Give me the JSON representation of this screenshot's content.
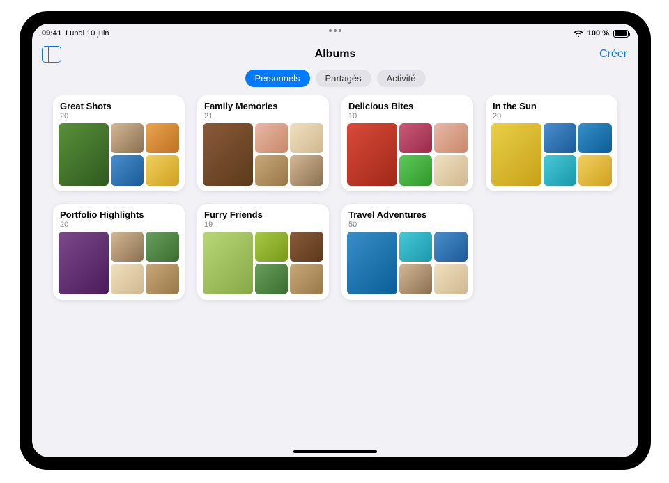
{
  "status": {
    "time": "09:41",
    "date": "Lundi 10 juin",
    "battery_pct": "100 %"
  },
  "nav": {
    "title": "Albums",
    "create_label": "Créer"
  },
  "tabs": [
    {
      "label": "Personnels",
      "active": true
    },
    {
      "label": "Partagés",
      "active": false
    },
    {
      "label": "Activité",
      "active": false
    }
  ],
  "albums": [
    {
      "title": "Great Shots",
      "count": "20",
      "thumbs": [
        "c1",
        "c2",
        "c3",
        "c4",
        "c5"
      ]
    },
    {
      "title": "Family Memories",
      "count": "21",
      "thumbs": [
        "c8",
        "c11",
        "c13",
        "c20",
        "c2"
      ]
    },
    {
      "title": "Delicious Bites",
      "count": "10",
      "thumbs": [
        "c6",
        "c9",
        "c11",
        "c10",
        "c13"
      ]
    },
    {
      "title": "In the Sun",
      "count": "20",
      "thumbs": [
        "c16",
        "c4",
        "c12",
        "c17",
        "c5"
      ]
    },
    {
      "title": "Portfolio Highlights",
      "count": "20",
      "thumbs": [
        "c15",
        "c2",
        "c7",
        "c13",
        "c20"
      ]
    },
    {
      "title": "Furry Friends",
      "count": "19",
      "thumbs": [
        "c14",
        "c19",
        "c8",
        "c7",
        "c20"
      ]
    },
    {
      "title": "Travel Adventures",
      "count": "50",
      "thumbs": [
        "c12",
        "c17",
        "c4",
        "c2",
        "c13"
      ]
    }
  ]
}
